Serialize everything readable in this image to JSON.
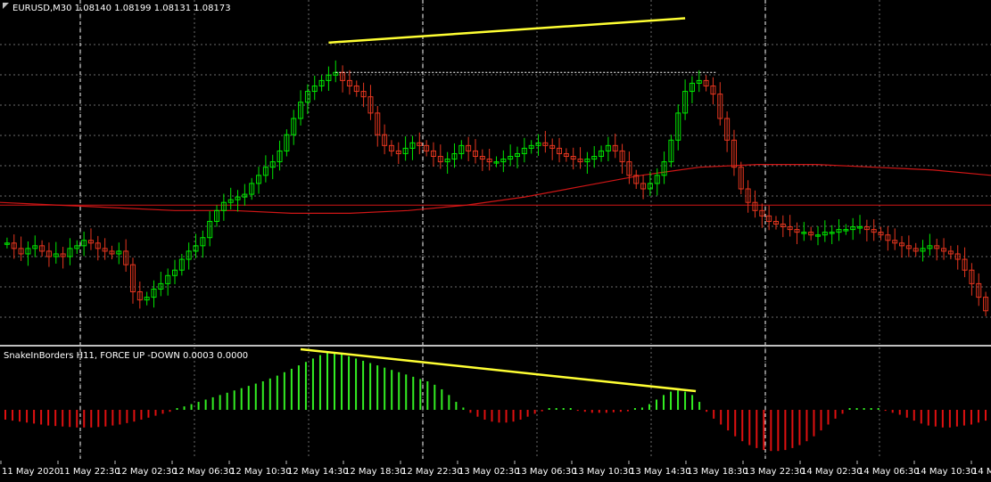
{
  "main_label": "EURUSD,M30  1.08140 1.08199 1.08131 1.08173",
  "indicator_label": "SnakeInBorders H11, FORCE UP -DOWN  0.0003 0.0000",
  "colors": {
    "background": "#000000",
    "grid": "#6b6b6b",
    "bull": "#00e600",
    "bear": "#e6361f",
    "ma": "#d01616",
    "trend": "#ffff33",
    "hist_up": "#33ee22",
    "hist_down": "#e01010"
  },
  "chart_data": [
    {
      "type": "candlestick",
      "symbol": "EURUSD",
      "timeframe": "M30",
      "x_labels": [
        "11 May 2020",
        "11 May 22:30",
        "12 May 02:30",
        "12 May 06:30",
        "12 May 10:30",
        "12 May 14:30",
        "12 May 18:30",
        "12 May 22:30",
        "13 May 02:30",
        "13 May 06:30",
        "13 May 10:30",
        "13 May 14:30",
        "13 May 18:30",
        "13 May 22:30",
        "14 May 02:30",
        "14 May 06:30",
        "14 May 10:30",
        "14 M..."
      ],
      "shape": [
        0.3,
        0.28,
        0.26,
        0.28,
        0.29,
        0.27,
        0.25,
        0.26,
        0.25,
        0.28,
        0.29,
        0.31,
        0.3,
        0.28,
        0.27,
        0.26,
        0.27,
        0.22,
        0.12,
        0.09,
        0.1,
        0.13,
        0.15,
        0.18,
        0.2,
        0.24,
        0.27,
        0.29,
        0.32,
        0.38,
        0.42,
        0.45,
        0.46,
        0.47,
        0.48,
        0.52,
        0.55,
        0.58,
        0.6,
        0.64,
        0.7,
        0.76,
        0.82,
        0.86,
        0.88,
        0.9,
        0.92,
        0.93,
        0.9,
        0.88,
        0.86,
        0.84,
        0.78,
        0.7,
        0.66,
        0.64,
        0.63,
        0.65,
        0.67,
        0.66,
        0.64,
        0.62,
        0.6,
        0.61,
        0.63,
        0.66,
        0.64,
        0.62,
        0.61,
        0.6,
        0.6,
        0.61,
        0.62,
        0.63,
        0.65,
        0.66,
        0.67,
        0.66,
        0.65,
        0.63,
        0.62,
        0.61,
        0.6,
        0.61,
        0.62,
        0.64,
        0.66,
        0.64,
        0.6,
        0.55,
        0.52,
        0.5,
        0.52,
        0.55,
        0.6,
        0.68,
        0.78,
        0.86,
        0.89,
        0.9,
        0.88,
        0.85,
        0.76,
        0.68,
        0.58,
        0.5,
        0.45,
        0.42,
        0.4,
        0.38,
        0.37,
        0.36,
        0.35,
        0.34,
        0.34,
        0.33,
        0.33,
        0.34,
        0.34,
        0.35,
        0.35,
        0.36,
        0.36,
        0.35,
        0.34,
        0.33,
        0.31,
        0.3,
        0.29,
        0.28,
        0.27,
        0.28,
        0.29,
        0.28,
        0.27,
        0.26,
        0.24,
        0.2,
        0.15,
        0.1,
        0.05
      ],
      "moving_average": [
        0.45,
        0.44,
        0.43,
        0.42,
        0.42,
        0.41,
        0.41,
        0.42,
        0.44,
        0.47,
        0.51,
        0.55,
        0.58,
        0.59,
        0.59,
        0.58,
        0.57,
        0.55
      ],
      "horizontal_level": 0.44
    },
    {
      "type": "histogram",
      "name": "SnakeInBorders H11, FORCE UP -DOWN",
      "values_text": "0.0003 0.0000",
      "shape": [
        -0.2,
        -0.22,
        -0.24,
        -0.26,
        -0.28,
        -0.3,
        -0.32,
        -0.33,
        -0.34,
        -0.35,
        -0.36,
        -0.36,
        -0.36,
        -0.35,
        -0.34,
        -0.32,
        -0.3,
        -0.27,
        -0.24,
        -0.2,
        -0.16,
        -0.12,
        -0.08,
        -0.04,
        0.02,
        0.06,
        0.1,
        0.14,
        0.18,
        0.22,
        0.26,
        0.3,
        0.34,
        0.38,
        0.42,
        0.46,
        0.5,
        0.55,
        0.6,
        0.66,
        0.72,
        0.78,
        0.84,
        0.9,
        0.96,
        1.0,
        1.0,
        0.98,
        0.94,
        0.9,
        0.86,
        0.82,
        0.78,
        0.74,
        0.7,
        0.66,
        0.62,
        0.58,
        0.54,
        0.5,
        0.44,
        0.36,
        0.26,
        0.14,
        0.04,
        -0.06,
        -0.14,
        -0.2,
        -0.24,
        -0.26,
        -0.26,
        -0.24,
        -0.2,
        -0.14,
        -0.08,
        -0.03,
        0.01,
        0.01,
        0.01,
        0.0,
        -0.02,
        -0.04,
        -0.06,
        -0.06,
        -0.06,
        -0.05,
        -0.04,
        -0.03,
        0.0,
        0.04,
        0.1,
        0.18,
        0.26,
        0.32,
        0.34,
        0.32,
        0.26,
        0.14,
        -0.04,
        -0.18,
        -0.3,
        -0.42,
        -0.54,
        -0.64,
        -0.72,
        -0.78,
        -0.82,
        -0.84,
        -0.84,
        -0.82,
        -0.78,
        -0.72,
        -0.64,
        -0.54,
        -0.42,
        -0.3,
        -0.18,
        -0.08,
        0.0,
        0.01,
        0.01,
        0.01,
        0.0,
        -0.02,
        -0.06,
        -0.1,
        -0.16,
        -0.22,
        -0.28,
        -0.32,
        -0.34,
        -0.36,
        -0.36,
        -0.34,
        -0.32,
        -0.3,
        -0.26,
        -0.22
      ]
    }
  ]
}
